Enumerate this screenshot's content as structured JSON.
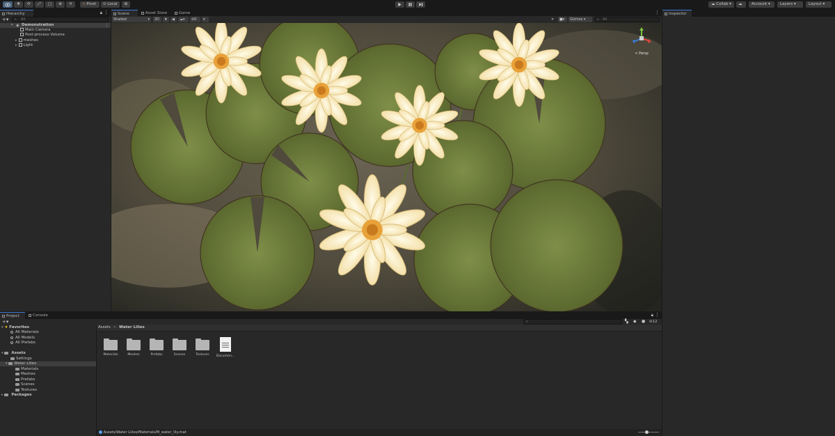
{
  "toolbar": {
    "pivot_label": "Pivot",
    "local_label": "Local",
    "collab_label": "Collab",
    "account_label": "Account",
    "layers_label": "Layers",
    "layout_label": "Layout"
  },
  "hierarchy": {
    "tab_label": "Hierarchy",
    "search_placeholder": "All",
    "items": [
      {
        "label": "Demonstration"
      },
      {
        "label": "Main Camera"
      },
      {
        "label": "Post-process Volume"
      },
      {
        "label": "meshes"
      },
      {
        "label": "Light"
      }
    ]
  },
  "scene_tabs": [
    {
      "label": "Scene"
    },
    {
      "label": "Asset Store"
    },
    {
      "label": "Game"
    }
  ],
  "scene_toolbar": {
    "shading_mode": "Shaded",
    "mode_2d": "2D",
    "hidden_count": "0",
    "gizmos_label": "Gizmos",
    "search_placeholder": "All",
    "persp_label": "< Persp"
  },
  "inspector": {
    "tab_label": "Inspector"
  },
  "project": {
    "tabs": [
      {
        "label": "Project"
      },
      {
        "label": "Console"
      }
    ],
    "favorites_label": "Favorites",
    "favorites": [
      {
        "label": "All Materials"
      },
      {
        "label": "All Models"
      },
      {
        "label": "All Prefabs"
      }
    ],
    "assets_label": "Assets",
    "assets_tree": [
      {
        "label": "Settings"
      },
      {
        "label": "Water Lilies"
      },
      {
        "label": "Materials"
      },
      {
        "label": "Meshes"
      },
      {
        "label": "Prefabs"
      },
      {
        "label": "Scenes"
      },
      {
        "label": "Textures"
      }
    ],
    "packages_label": "Packages",
    "breadcrumb": {
      "root": "Assets",
      "separator": ">",
      "current": "Water Lilies"
    },
    "grid_items": [
      {
        "label": "Materials",
        "icon": "folder-icon"
      },
      {
        "label": "Meshes",
        "icon": "folder-icon"
      },
      {
        "label": "Prefabs",
        "icon": "folder-icon"
      },
      {
        "label": "Scenes",
        "icon": "folder-icon"
      },
      {
        "label": "Textures",
        "icon": "folder-icon"
      },
      {
        "label": "Documen...",
        "icon": "document-icon"
      }
    ],
    "visible_count": "12",
    "status_path": "Assets/Water Lilies/Materials/M_water_lily.mat"
  },
  "colors": {
    "accent": "#3a7bd5",
    "panel": "#282828",
    "background": "#191919"
  }
}
